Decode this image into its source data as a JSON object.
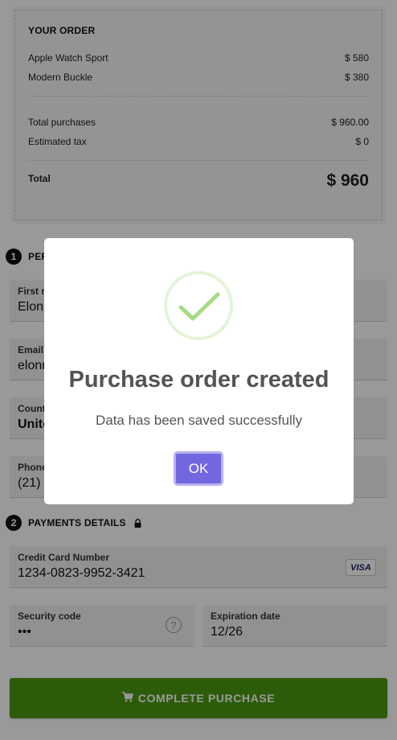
{
  "order": {
    "title": "YOUR ORDER",
    "items": [
      {
        "name": "Apple Watch Sport",
        "price": "$ 580"
      },
      {
        "name": "Modern Buckle",
        "price": "$ 380"
      }
    ],
    "total_purchases_label": "Total purchases",
    "total_purchases_value": "$ 960.00",
    "tax_label": "Estimated tax",
    "tax_value": "$ 0",
    "total_label": "Total",
    "total_value": "$ 960"
  },
  "personal": {
    "step": "1",
    "title_visible": "PER",
    "fields": [
      {
        "label": "First n",
        "value": "Elon"
      },
      {
        "label": "Email",
        "value": "elonr"
      },
      {
        "label": "Count",
        "value": "Unite"
      },
      {
        "label": "Phone",
        "value": "(21)"
      }
    ]
  },
  "payments": {
    "step": "2",
    "title": "PAYMENTS DETAILS",
    "lock_icon": "lock-icon",
    "card_label": "Credit Card Number",
    "card_value": "1234-0823-9952-3421",
    "card_brand": "VISA",
    "security_label": "Security code",
    "security_value": "•••",
    "help_glyph": "?",
    "expiration_label": "Expiration date",
    "expiration_value": "12/26"
  },
  "purchase_button": {
    "label": "COMPLETE PURCHASE",
    "icon": "cart-icon",
    "color": "#4a9a10"
  },
  "modal": {
    "icon": "success-check-icon",
    "title": "Purchase order created",
    "message": "Data has been saved successfully",
    "ok_label": "OK",
    "ok_color": "#7367e0",
    "check_color": "#a5dc86"
  }
}
